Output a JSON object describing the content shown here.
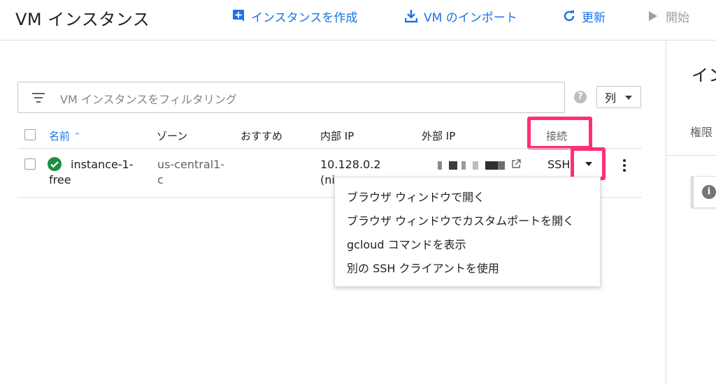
{
  "header": {
    "title": "VM インスタンス",
    "actions": {
      "create": "インスタンスを作成",
      "import": "VM のインポート",
      "refresh": "更新",
      "start": "開始"
    }
  },
  "filter": {
    "placeholder": "VM インスタンスをフィルタリング"
  },
  "toolbar": {
    "help": "?",
    "columns_label": "列"
  },
  "table": {
    "headers": {
      "name": "名前",
      "zone": "ゾーン",
      "recommendation": "おすすめ",
      "internal_ip": "内部 IP",
      "external_ip": "外部 IP",
      "connect": "接続"
    },
    "rows": [
      {
        "name": "instance-1-free",
        "zone": "us-central1-c",
        "internal_ip": "10.128.0.2 (ni",
        "connect": "SSH",
        "status_color": "#1e8e3e"
      }
    ]
  },
  "ssh_menu": {
    "items": [
      "ブラウザ ウィンドウで開く",
      "ブラウザ ウィンドウでカスタムポートを開く",
      "gcloud コマンドを表示",
      "別の SSH クライアントを使用"
    ]
  },
  "side_panel": {
    "heading": "イン",
    "subtitle": "権限"
  },
  "colors": {
    "accent": "#1a73e8",
    "highlight": "#ff2d7a",
    "status_ok": "#1e8e3e"
  }
}
